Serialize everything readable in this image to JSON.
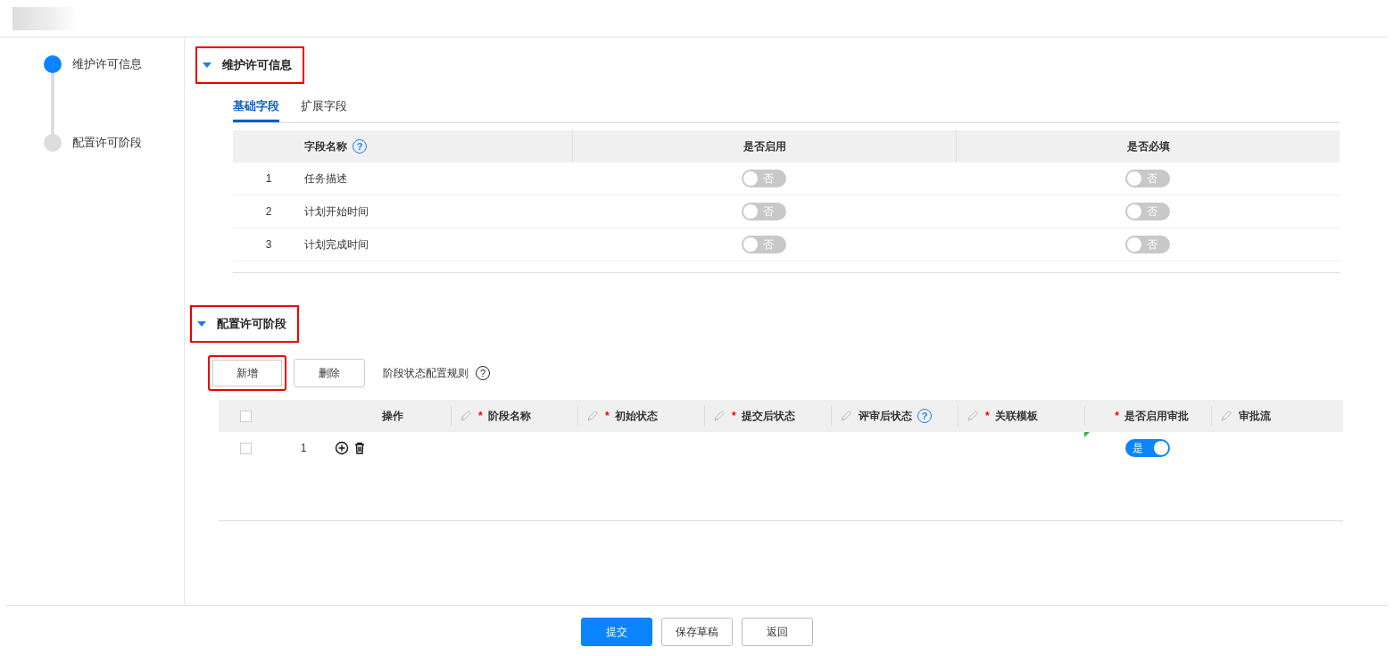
{
  "steps": [
    {
      "label": "维护许可信息",
      "selected": true
    },
    {
      "label": "配置许可阶段",
      "selected": false
    }
  ],
  "section_info": {
    "title": "维护许可信息",
    "expanded": true,
    "highlighted": true,
    "tabs": [
      {
        "label": "基础字段",
        "selected": true
      },
      {
        "label": "扩展字段",
        "selected": false
      }
    ],
    "table": {
      "columns": [
        {
          "label": "字段名称",
          "help": "?"
        },
        {
          "label": "是否启用"
        },
        {
          "label": "是否必填"
        }
      ],
      "rows": [
        {
          "index": "1",
          "name": "任务描述",
          "enabled": {
            "on": false,
            "label": "否"
          },
          "required": {
            "on": false,
            "label": "否"
          }
        },
        {
          "index": "2",
          "name": "计划开始时间",
          "enabled": {
            "on": false,
            "label": "否"
          },
          "required": {
            "on": false,
            "label": "否"
          }
        },
        {
          "index": "3",
          "name": "计划完成时间",
          "enabled": {
            "on": false,
            "label": "否"
          },
          "required": {
            "on": false,
            "label": "否"
          }
        }
      ]
    }
  },
  "section_stages": {
    "title": "配置许可阶段",
    "expanded": true,
    "highlighted": true,
    "buttons": [
      {
        "label": "新增",
        "highlighted": true
      },
      {
        "label": "删除",
        "highlighted": false
      }
    ],
    "rule_label": "阶段状态配置规则",
    "rule_help": "?",
    "table": {
      "select_all_checked": false,
      "columns": [
        {
          "label": "操作",
          "editable": false
        },
        {
          "label": "阶段名称",
          "editable": true,
          "required_mark": "*"
        },
        {
          "label": "初始状态",
          "editable": true,
          "required_mark": "*"
        },
        {
          "label": "提交后状态",
          "editable": true,
          "required_mark": "*"
        },
        {
          "label": "评审后状态",
          "editable": true,
          "help": "?"
        },
        {
          "label": "关联模板",
          "editable": true,
          "required_mark": "*"
        },
        {
          "label": "是否启用审批",
          "editable": false,
          "required_mark": "*"
        },
        {
          "label": "审批流",
          "editable": true
        }
      ],
      "rows": [
        {
          "checked": false,
          "index": "1",
          "modified": true,
          "approval": {
            "on": true,
            "label": "是"
          }
        }
      ]
    }
  },
  "footer_buttons": [
    {
      "label": "提交",
      "kind": "primary"
    },
    {
      "label": "保存草稿",
      "kind": "default"
    },
    {
      "label": "返回",
      "kind": "default"
    }
  ]
}
